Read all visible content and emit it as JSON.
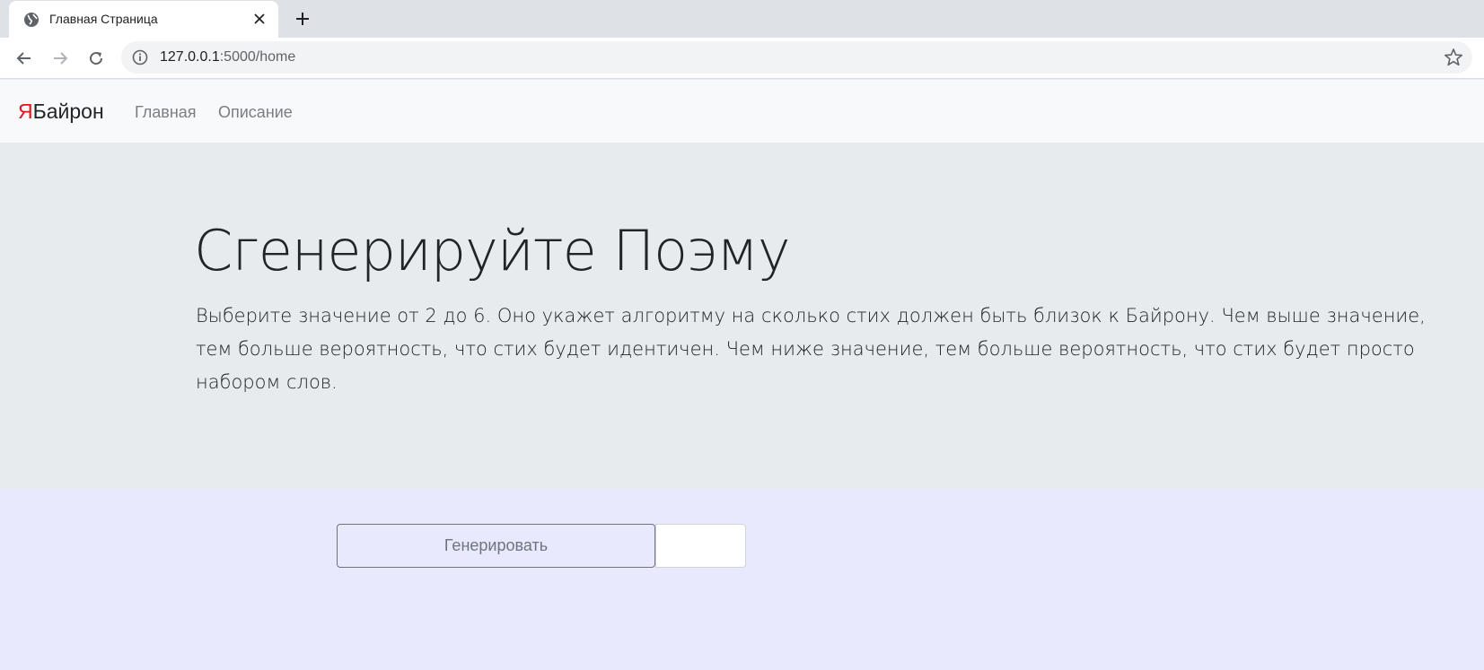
{
  "browser": {
    "tab_title": "Главная Страница",
    "url_host": "127.0.0.1",
    "url_rest": ":5000/home"
  },
  "navbar": {
    "brand_ya": "Я",
    "brand_rest": "Байрон",
    "links": [
      "Главная",
      "Описание"
    ]
  },
  "jumbotron": {
    "title": "Сгенерируйте Поэму",
    "lead": "Выберите значение от 2 до 6. Оно укажет алгоритму на сколько стих должен быть близок к Байрону. Чем выше значение, тем больше вероятность, что стих будет идентичен. Чем ниже значение, тем больше вероятность, что стих будет просто набором слов."
  },
  "form": {
    "generate_label": "Генерировать",
    "number_value": ""
  },
  "colors": {
    "brand_accent": "#e0141e",
    "page_bg": "#e9e9fd",
    "jumbotron_bg": "#e8ebee"
  }
}
